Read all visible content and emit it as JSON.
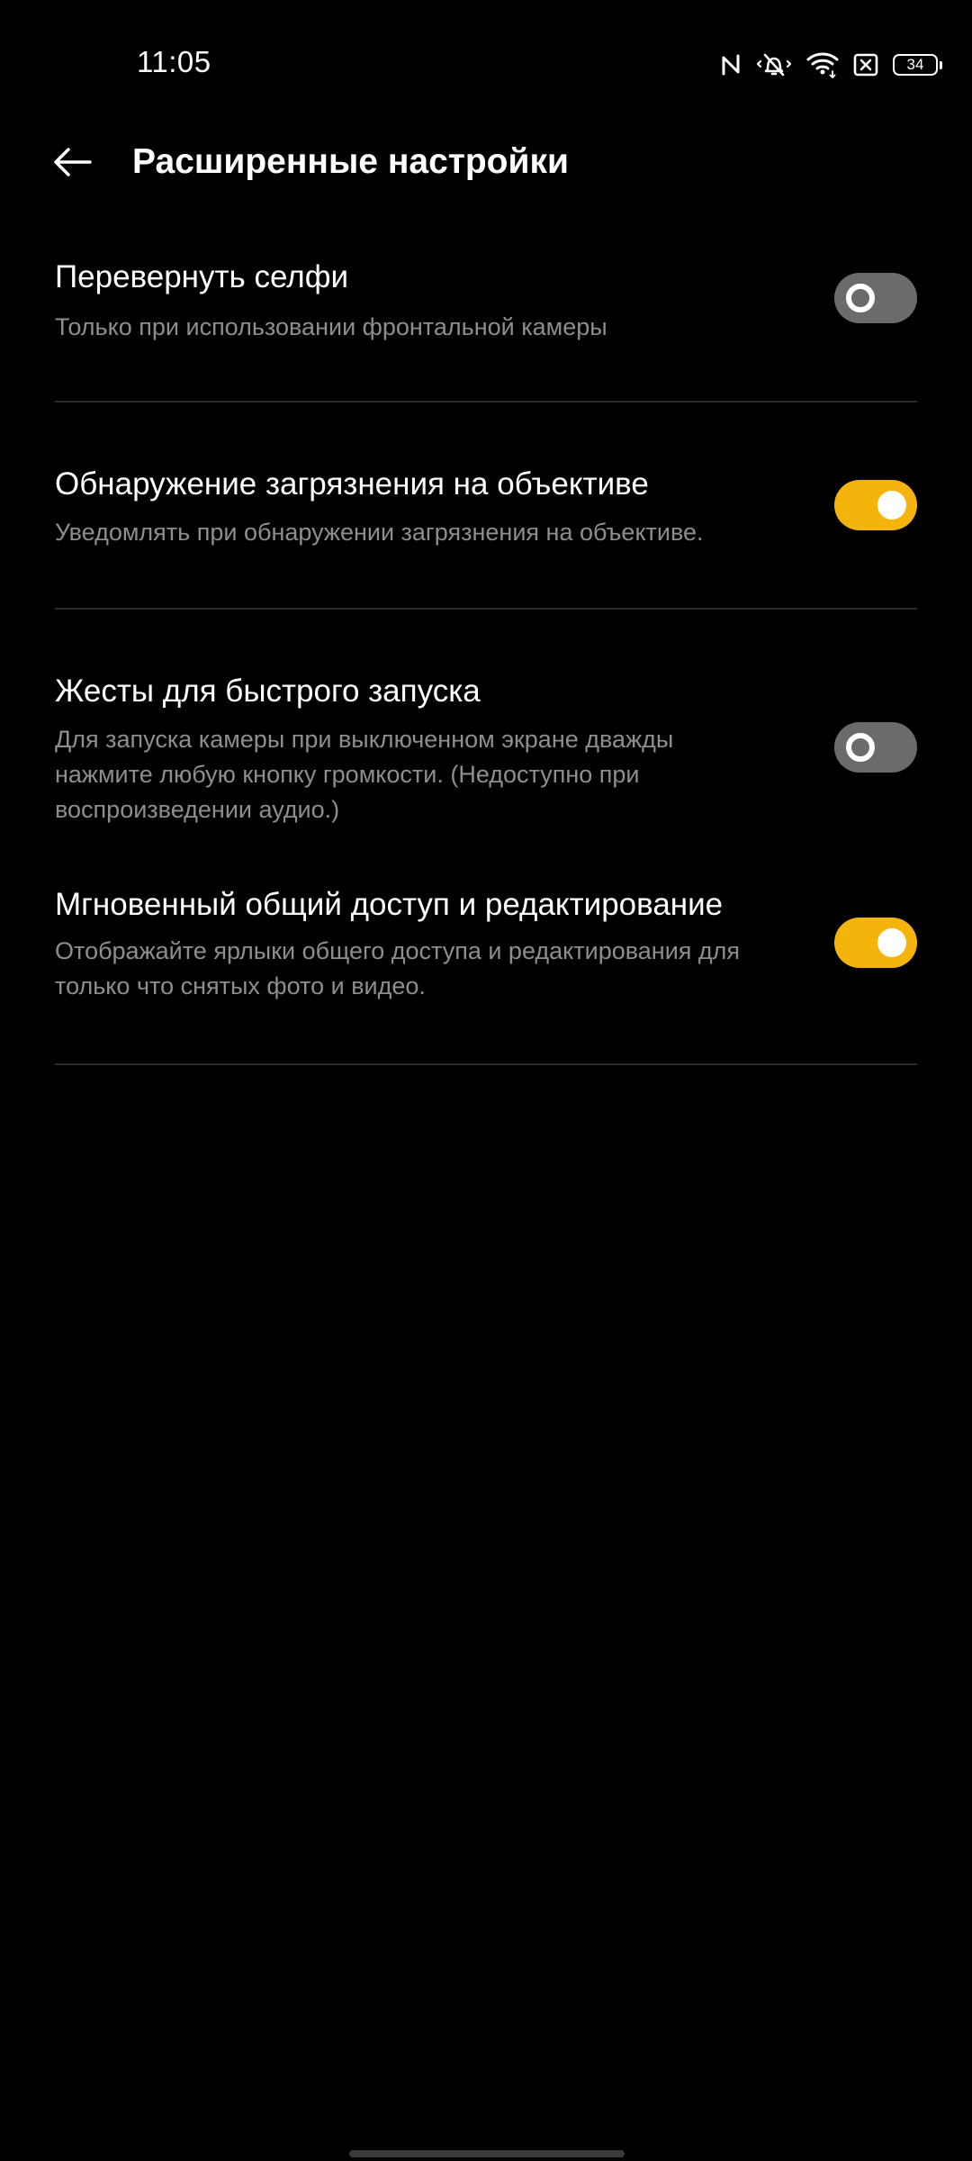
{
  "status_bar": {
    "time": "11:05",
    "battery_level": "34",
    "icons": [
      "nfc-icon",
      "vibrate-icon",
      "wifi-icon",
      "sim-off-icon",
      "battery-icon"
    ]
  },
  "header": {
    "title": "Расширенные настройки",
    "back_icon": "arrow-left-icon"
  },
  "settings": [
    {
      "title": "Перевернуть селфи",
      "description": "Только при использовании фронтальной камеры",
      "enabled": false
    },
    {
      "title": "Обнаружение загрязнения на объективе",
      "description": "Уведомлять при обнаружении загрязнения на объективе.",
      "enabled": true
    },
    {
      "title": "Жесты для быстрого запуска",
      "description": "Для запуска камеры при выключенном экране дважды нажмите любую кнопку громкости. (Недоступно при воспроизведении аудио.)",
      "enabled": false
    },
    {
      "title": "Мгновенный общий доступ и редактирование",
      "description": "Отображайте ярлыки общего доступа и редактирования для только что снятых фото и видео.",
      "enabled": true
    }
  ],
  "colors": {
    "background": "#000000",
    "toggle_on": "#f5b40c",
    "toggle_off": "#6b6b6b",
    "text_primary": "#ffffff",
    "text_secondary": "#8e8e8e",
    "divider": "#2b2b2b"
  }
}
